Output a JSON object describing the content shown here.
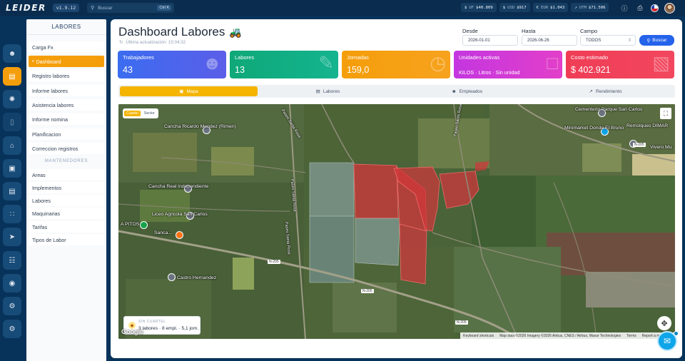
{
  "app": {
    "logo": "LEIDER",
    "version": "v1.9.12"
  },
  "search": {
    "placeholder": "Buscar",
    "shortcut": "Ctrl K"
  },
  "rates": [
    {
      "label": "UF",
      "value": "$40.809"
    },
    {
      "label": "USD",
      "value": "$917"
    },
    {
      "label": "EUR",
      "value": "$1.043"
    },
    {
      "label": "UTM",
      "value": "$71.506"
    }
  ],
  "sidebar": {
    "title": "LABORES",
    "items": [
      "Carga Fx",
      "Dashboard",
      "Registro labores",
      "Informe labores",
      "Asistencia labores",
      "Informe nomina",
      "Planificacion",
      "Correccion registros"
    ],
    "section": "MANTENEDORES",
    "maint_items": [
      "Areas",
      "Implementos",
      "Labores",
      "Maquinarias",
      "Tarifas",
      "Tipos de Labor"
    ]
  },
  "header": {
    "title": "Dashboard Labores",
    "title_emoji": "🚜",
    "updated": "Última actualización: 15:04:32"
  },
  "filters": {
    "desde_label": "Desde",
    "desde_value": "2026-01-01",
    "hasta_label": "Hasta",
    "hasta_value": "2026-06-26",
    "campo_label": "Campo",
    "campo_value": "TODOS",
    "buscar_label": "Buscar"
  },
  "cards": [
    {
      "label": "Trabajadores",
      "value": "43",
      "color": "#4f6cf0"
    },
    {
      "label": "Labores",
      "value": "13",
      "color": "#0fa37f"
    },
    {
      "label": "Jornadas",
      "value": "159,0",
      "color": "#f59e0b"
    },
    {
      "label": "Unidades activas",
      "value": "KILOS · Litros · Sin unidad",
      "color": "#d63ad8"
    },
    {
      "label": "Costo estimado",
      "value": "$ 402.921",
      "color": "#f0415b"
    }
  ],
  "tabs": [
    "Mapa",
    "Labores",
    "Empleados",
    "Rendimiento"
  ],
  "map": {
    "toggle_on": "Cuartel",
    "toggle_off": "Sector",
    "places": [
      "Cancha Ricardo Mendez (Rimen)",
      "Cancha Real Independiente",
      "Liceo Agricola San Carlos",
      "Castro Hernandez",
      "Cementerio Parque San Carlos",
      "Minimarket Donde El Bruno",
      "Remolques DIMAR",
      "Vivero Mu",
      "Sanca...",
      "A PITOS"
    ],
    "roads": [
      "Paseo Santa Rosa",
      "Paseo Santa Rosa",
      "N-205",
      "N-205",
      "N-205",
      "N-205",
      "Paseo Santa Rosa",
      "Paseo Santa Rosa"
    ],
    "info_title": "SIN CUARTEL",
    "info_detail": "3 labores · 8 empl. · 5,1 jorn.",
    "attribution": [
      "Keyboard shortcuts",
      "Map data ©2026 Imagery ©2026 Airbus, CNES / Airbus, Maxar Technologies",
      "Terms",
      "Report a map error"
    ],
    "google": "Google"
  }
}
